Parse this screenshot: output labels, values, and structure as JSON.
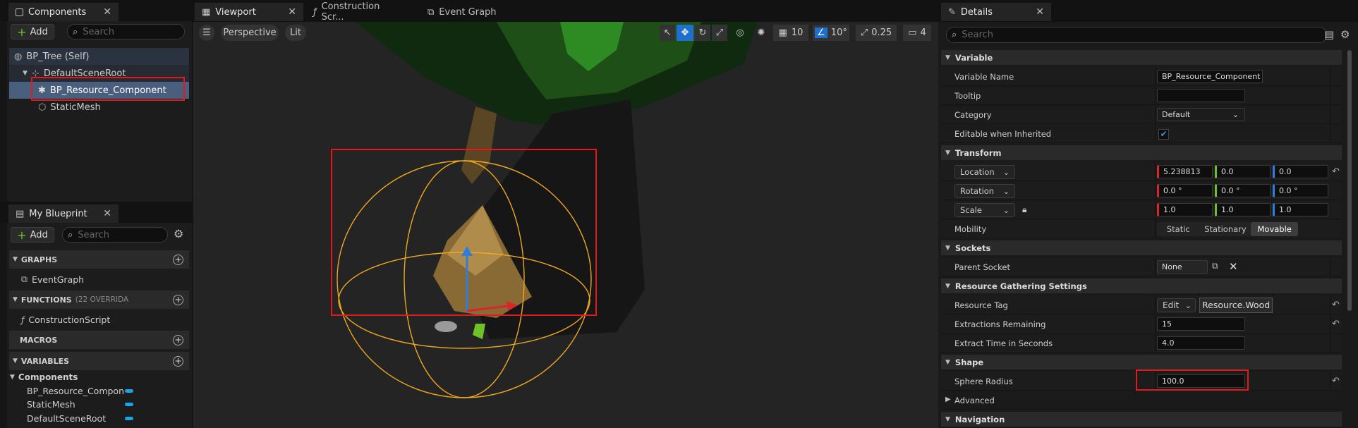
{
  "components_panel": {
    "tab_label": "Components",
    "add_label": "Add",
    "search_placeholder": "Search",
    "tree": [
      {
        "label": "BP_Tree (Self)"
      },
      {
        "label": "DefaultSceneRoot"
      },
      {
        "label": "BP_Resource_Component"
      },
      {
        "label": "StaticMesh"
      }
    ]
  },
  "blueprint_panel": {
    "tab_label": "My Blueprint",
    "add_label": "Add",
    "search_placeholder": "Search",
    "sections": {
      "graphs": "GRAPHS",
      "functions": "FUNCTIONS",
      "functions_note": "(22 OVERRIDA",
      "macros": "MACROS",
      "variables": "VARIABLES"
    },
    "graph_items": [
      "EventGraph"
    ],
    "function_items": [
      "ConstructionScript"
    ],
    "variable_category": "Components",
    "variables": [
      {
        "name": "BP_Resource_Compon"
      },
      {
        "name": "StaticMesh"
      },
      {
        "name": "DefaultSceneRoot"
      }
    ],
    "variable_pill_color": "#1aa4ea"
  },
  "editor_tabs": [
    {
      "label": "Viewport"
    },
    {
      "label": "Construction Scr..."
    },
    {
      "label": "Event Graph"
    }
  ],
  "viewport": {
    "perspective_label": "Perspective",
    "lit_label": "Lit",
    "grid_snap": "10",
    "rotation_snap": "10°",
    "scale_snap": "0.25",
    "camera_speed": "4"
  },
  "details_panel": {
    "tab_label": "Details",
    "search_placeholder": "Search",
    "sections": {
      "variable": "Variable",
      "transform": "Transform",
      "sockets": "Sockets",
      "resource": "Resource Gathering Settings",
      "shape": "Shape",
      "advanced": "Advanced",
      "navigation": "Navigation"
    },
    "variable_name_label": "Variable Name",
    "variable_name_value": "BP_Resource_Component",
    "tooltip_label": "Tooltip",
    "category_label": "Category",
    "category_value": "Default",
    "editable_label": "Editable when Inherited",
    "location_label": "Location",
    "location": [
      "5.238813",
      "0.0",
      "0.0"
    ],
    "rotation_label": "Rotation",
    "rotation": [
      "0.0 °",
      "0.0 °",
      "0.0 °"
    ],
    "scale_label": "Scale",
    "scale": [
      "1.0",
      "1.0",
      "1.0"
    ],
    "mobility_label": "Mobility",
    "mobility_options": [
      "Static",
      "Stationary",
      "Movable"
    ],
    "parent_socket_label": "Parent Socket",
    "parent_socket_value": "None",
    "resource_tag_label": "Resource Tag",
    "resource_tag_edit": "Edit",
    "resource_tag_value": "Resource.Wood",
    "extractions_label": "Extractions Remaining",
    "extractions_value": "15",
    "extract_time_label": "Extract Time in Seconds",
    "extract_time_value": "4.0",
    "sphere_radius_label": "Sphere Radius",
    "sphere_radius_value": "100.0"
  },
  "colors": {
    "accent": "#1f6fd0",
    "highlight": "#e01b1b",
    "sphere": "#f0a820",
    "x_axis": "#d8262c",
    "y_axis": "#6fc12a",
    "z_axis": "#2c7ee0"
  }
}
